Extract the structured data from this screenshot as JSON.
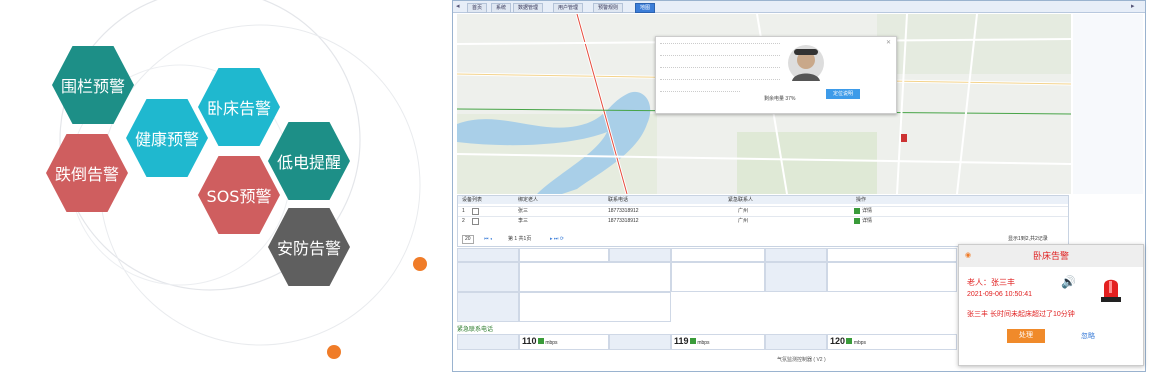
{
  "features": {
    "fence_warning": "围栏预警",
    "health_warning": "健康预警",
    "bed_alarm": "卧床告警",
    "fall_alarm": "跌倒告警",
    "sos_warning": "SOS预警",
    "low_battery": "低电提醒",
    "security_alarm": "安防告警"
  },
  "app": {
    "tabs": [
      "首页",
      "系统",
      "数据管理",
      "用户管理",
      "预警规则",
      "地图"
    ],
    "active_tab": "地图",
    "popup": {
      "battery_label": "剩余电量 37%",
      "confirm_label": "定位说明"
    },
    "table": {
      "header": "设备列表",
      "columns": [
        "绑定老人",
        "联系电话",
        "紧急联系人",
        "操作"
      ],
      "rows": [
        {
          "index": "1",
          "name": "张三",
          "phone": "18773318912",
          "contact": "广州",
          "action": "详情"
        },
        {
          "index": "2",
          "name": "李三",
          "phone": "18773318912",
          "contact": "广州",
          "action": "详情"
        }
      ],
      "page_size": "20",
      "page_text": "第 1 共1页",
      "pager_info": "显示1到2,共2记录"
    },
    "form": {
      "section_label": "紧急联系电话",
      "values": [
        {
          "value": "110",
          "unit": "mbps"
        },
        {
          "value": "119",
          "unit": "mbps"
        },
        {
          "value": "120",
          "unit": "mbps"
        }
      ],
      "footer_text": "气氛监测控制器 ( V2 )"
    },
    "alarm": {
      "title": "卧床告警",
      "person": "老人：张三丰",
      "time": "2021-09-06 10:50:41",
      "message": "张三丰 长时间未起床超过了10分钟",
      "handle_button": "处理",
      "ignore_button": "忽略"
    }
  },
  "colors": {
    "teal": "#1d8f87",
    "cyan": "#1fb8cf",
    "red": "#cf5e5f",
    "gray": "#5f5f5f",
    "orange": "#f07c28",
    "accent": "#3b7dd8"
  }
}
